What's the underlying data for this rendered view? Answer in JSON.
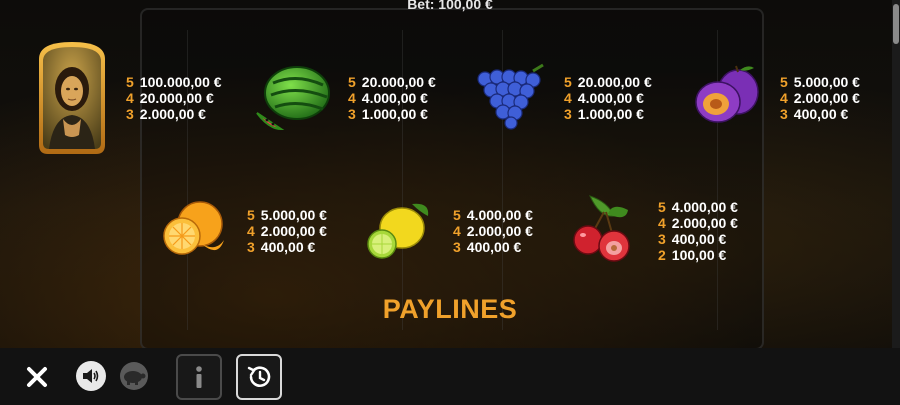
{
  "header": {
    "bet_text": "Bet: 100,00 €"
  },
  "paytable": {
    "symbols": [
      {
        "name": "mona-lisa",
        "pays": [
          {
            "count": "5",
            "amount": "100.000,00 €"
          },
          {
            "count": "4",
            "amount": "20.000,00 €"
          },
          {
            "count": "3",
            "amount": "2.000,00 €"
          }
        ]
      },
      {
        "name": "watermelon",
        "pays": [
          {
            "count": "5",
            "amount": "20.000,00 €"
          },
          {
            "count": "4",
            "amount": "4.000,00 €"
          },
          {
            "count": "3",
            "amount": "1.000,00 €"
          }
        ]
      },
      {
        "name": "grapes",
        "pays": [
          {
            "count": "5",
            "amount": "20.000,00 €"
          },
          {
            "count": "4",
            "amount": "4.000,00 €"
          },
          {
            "count": "3",
            "amount": "1.000,00 €"
          }
        ]
      },
      {
        "name": "plum",
        "pays": [
          {
            "count": "5",
            "amount": "5.000,00 €"
          },
          {
            "count": "4",
            "amount": "2.000,00 €"
          },
          {
            "count": "3",
            "amount": "400,00 €"
          }
        ]
      },
      {
        "name": "orange",
        "pays": [
          {
            "count": "5",
            "amount": "5.000,00 €"
          },
          {
            "count": "4",
            "amount": "2.000,00 €"
          },
          {
            "count": "3",
            "amount": "400,00 €"
          }
        ]
      },
      {
        "name": "lemon",
        "pays": [
          {
            "count": "5",
            "amount": "4.000,00 €"
          },
          {
            "count": "4",
            "amount": "2.000,00 €"
          },
          {
            "count": "3",
            "amount": "400,00 €"
          }
        ]
      },
      {
        "name": "cherries",
        "pays": [
          {
            "count": "5",
            "amount": "4.000,00 €"
          },
          {
            "count": "4",
            "amount": "2.000,00 €"
          },
          {
            "count": "3",
            "amount": "400,00 €"
          },
          {
            "count": "2",
            "amount": "100,00 €"
          }
        ]
      }
    ]
  },
  "section_title": "PAYLINES",
  "toolbar": {
    "icons": [
      "close-icon",
      "sound-icon",
      "turbo-turtle-icon",
      "info-icon",
      "history-icon"
    ]
  },
  "colors": {
    "accent": "#f0a12b",
    "text": "#ffffff",
    "background": "#0b0a08",
    "toolbar": "#121212"
  }
}
